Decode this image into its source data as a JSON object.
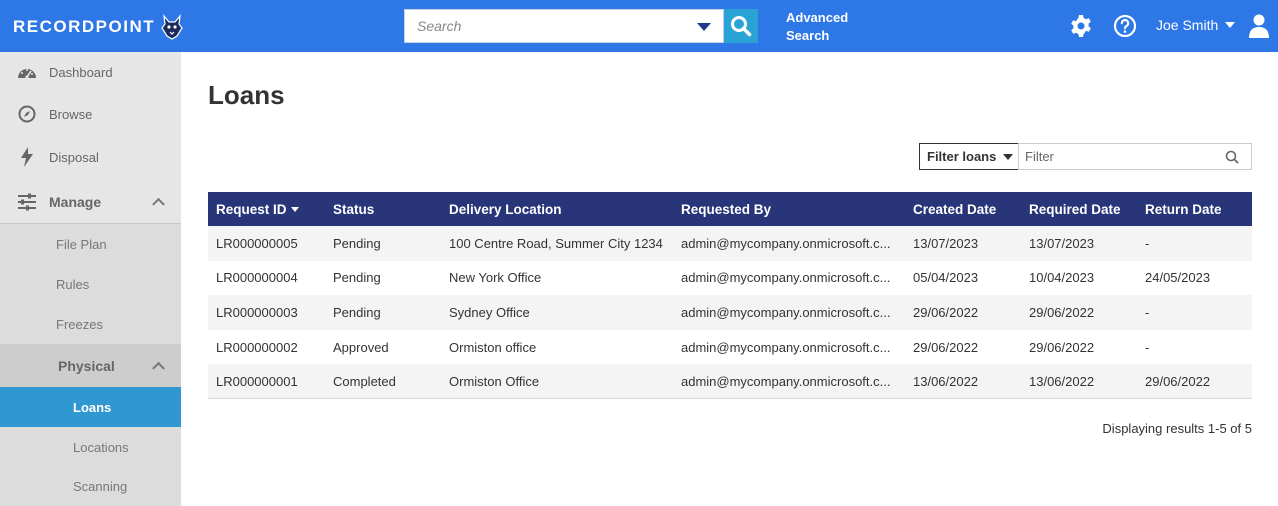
{
  "header": {
    "logo_text": "RECORDPOINT",
    "search_placeholder": "Search",
    "advanced_search": "Advanced Search",
    "user_name": "Joe Smith",
    "accent": "#2d77e6"
  },
  "sidebar": {
    "items": [
      {
        "label": "Dashboard",
        "icon": "dashboard-icon"
      },
      {
        "label": "Browse",
        "icon": "compass-icon"
      },
      {
        "label": "Disposal",
        "icon": "lightning-icon"
      }
    ],
    "manage": {
      "label": "Manage",
      "icon": "sliders-icon",
      "children": [
        "File Plan",
        "Rules",
        "Freezes"
      ],
      "physical": {
        "label": "Physical",
        "children": [
          "Loans",
          "Locations",
          "Scanning"
        ],
        "active": "Loans"
      }
    }
  },
  "main": {
    "title": "Loans",
    "filter_select": "Filter loans",
    "filter_placeholder": "Filter",
    "columns": [
      "Request ID",
      "Status",
      "Delivery Location",
      "Requested By",
      "Created Date",
      "Required Date",
      "Return Date"
    ],
    "rows": [
      {
        "id": "LR000000005",
        "status": "Pending",
        "location": "100 Centre Road, Summer City 1234",
        "requested_by": "admin@mycompany.onmicrosoft.c...",
        "created": "13/07/2023",
        "required": "13/07/2023",
        "returned": "-"
      },
      {
        "id": "LR000000004",
        "status": "Pending",
        "location": "New York Office",
        "requested_by": "admin@mycompany.onmicrosoft.c...",
        "created": "05/04/2023",
        "required": "10/04/2023",
        "returned": "24/05/2023"
      },
      {
        "id": "LR000000003",
        "status": "Pending",
        "location": "Sydney Office",
        "requested_by": "admin@mycompany.onmicrosoft.c...",
        "created": "29/06/2022",
        "required": "29/06/2022",
        "returned": "-"
      },
      {
        "id": "LR000000002",
        "status": "Approved",
        "location": "Ormiston office",
        "requested_by": "admin@mycompany.onmicrosoft.c...",
        "created": "29/06/2022",
        "required": "29/06/2022",
        "returned": "-"
      },
      {
        "id": "LR000000001",
        "status": "Completed",
        "location": "Ormiston Office",
        "requested_by": "admin@mycompany.onmicrosoft.c...",
        "created": "13/06/2022",
        "required": "13/06/2022",
        "returned": "29/06/2022"
      }
    ],
    "results_text": "Displaying results 1-5 of 5"
  }
}
